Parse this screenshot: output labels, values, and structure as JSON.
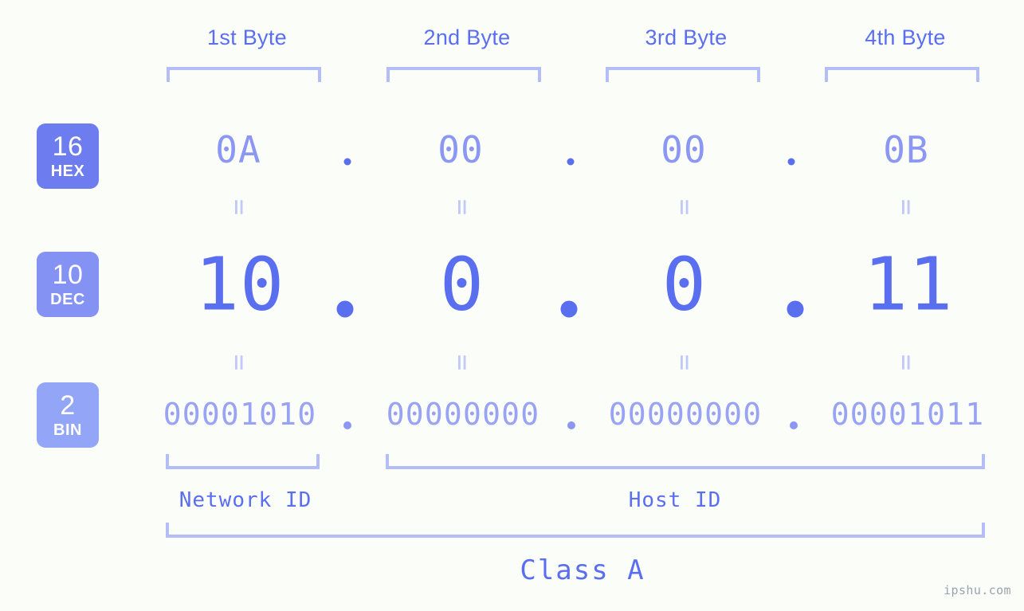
{
  "meta": {
    "background_color": "#fbfdf8",
    "accent_color": "#5a6ef0",
    "accent_light": "#8b97f2",
    "bracket_color": "#b5bdf7"
  },
  "headers": {
    "bytes": [
      {
        "label": "1st Byte"
      },
      {
        "label": "2nd Byte"
      },
      {
        "label": "3rd Byte"
      },
      {
        "label": "4th Byte"
      }
    ]
  },
  "bases": [
    {
      "num": "16",
      "system": "HEX",
      "color": "#6d7df0"
    },
    {
      "num": "10",
      "system": "DEC",
      "color": "#8392f3"
    },
    {
      "num": "2",
      "system": "BIN",
      "color": "#93a5f7"
    }
  ],
  "rows": {
    "hex": {
      "values": [
        "0A",
        "00",
        "00",
        "0B"
      ],
      "separator": "."
    },
    "dec": {
      "values": [
        "10",
        "0",
        "0",
        "11"
      ],
      "separator": "."
    },
    "bin": {
      "values": [
        "00001010",
        "00000000",
        "00000000",
        "00001011"
      ],
      "separator": "."
    }
  },
  "connectors": {
    "equals": "=",
    "count_per_gap": 4
  },
  "footer": {
    "network_id_label": "Network ID",
    "host_id_label": "Host ID",
    "class_label": "Class A"
  },
  "watermark": {
    "text": "ipshu.com"
  }
}
